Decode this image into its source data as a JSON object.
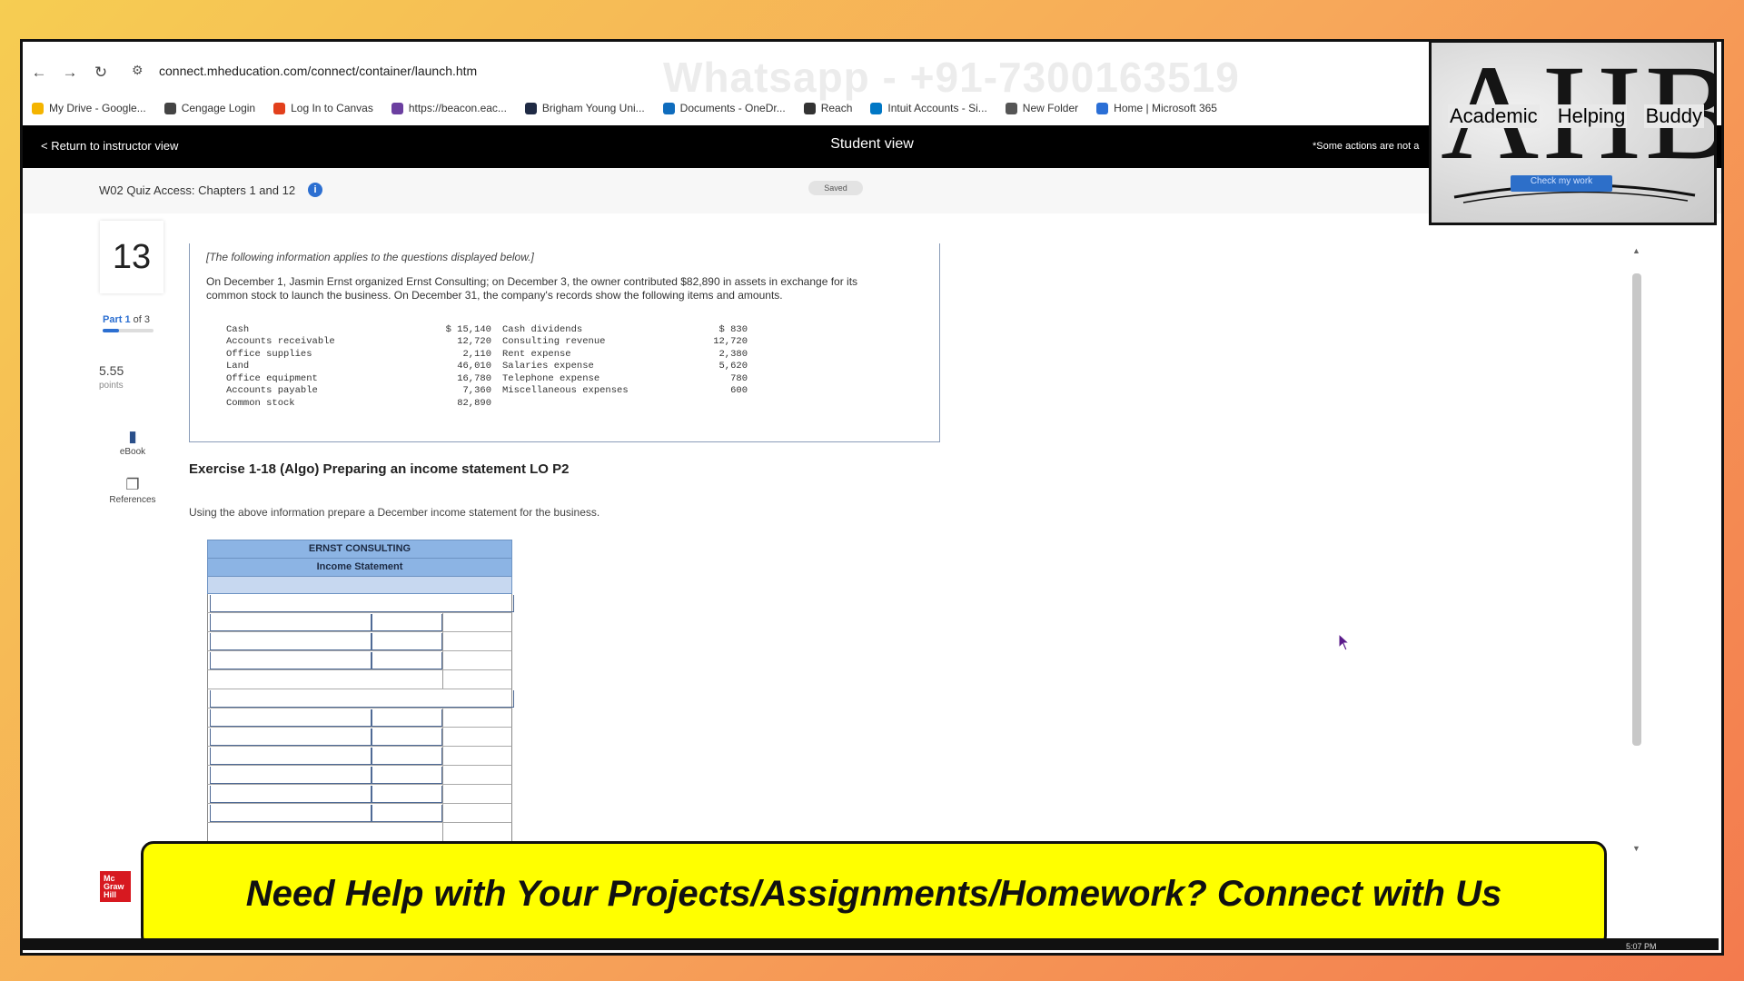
{
  "browser": {
    "url": "connect.mheducation.com/connect/container/launch.htm",
    "bookmarks": [
      {
        "label": "My Drive - Google...",
        "color": "#f4b400"
      },
      {
        "label": "Cengage Login",
        "color": "#444444"
      },
      {
        "label": "Log In to Canvas",
        "color": "#e2401c"
      },
      {
        "label": "https://beacon.eac...",
        "color": "#6b3fa0"
      },
      {
        "label": "Brigham Young Uni...",
        "color": "#1f2a44"
      },
      {
        "label": "Documents - OneDr...",
        "color": "#0f6cbd"
      },
      {
        "label": "Reach",
        "color": "#333333"
      },
      {
        "label": "Intuit Accounts - Si...",
        "color": "#0077c5"
      },
      {
        "label": "New Folder",
        "color": "#555555"
      },
      {
        "label": "Home | Microsoft 365",
        "color": "#2b6fd6"
      }
    ]
  },
  "watermark": "Whatsapp - +91-7300163519",
  "topbar": {
    "return_label": "< Return to instructor view",
    "center_label": "Student view",
    "right_note": "*Some actions are not a"
  },
  "subheader": {
    "quiz_title": "W02 Quiz Access: Chapters 1 and 12",
    "saved_label": "Saved",
    "check_work_label": "Check my work"
  },
  "question": {
    "number": "13",
    "part_prefix": "Part 1",
    "part_suffix": "of 3",
    "part_progress": 0.33,
    "points_value": "5.55",
    "points_label": "points",
    "tools": [
      {
        "label": "eBook",
        "icon": "book-icon"
      },
      {
        "label": "References",
        "icon": "document-icon"
      }
    ]
  },
  "info": {
    "italic_note": "[The following information applies to the questions displayed below.]",
    "paragraph": "On December 1, Jasmin Ernst organized Ernst Consulting; on December 3, the owner contributed $82,890 in assets in exchange for its common stock to launch the business. On December 31, the company's records show the following items and amounts.",
    "rows": [
      {
        "name": "Cash",
        "value": "$ 15,140",
        "name2": "Cash dividends",
        "value2": "$ 830"
      },
      {
        "name": "Accounts receivable",
        "value": "12,720",
        "name2": "Consulting revenue",
        "value2": "12,720"
      },
      {
        "name": "Office supplies",
        "value": "2,110",
        "name2": "Rent expense",
        "value2": "2,380"
      },
      {
        "name": "Land",
        "value": "46,010",
        "name2": "Salaries expense",
        "value2": "5,620"
      },
      {
        "name": "Office equipment",
        "value": "16,780",
        "name2": "Telephone expense",
        "value2": "780"
      },
      {
        "name": "Accounts payable",
        "value": "7,360",
        "name2": "Miscellaneous expenses",
        "value2": "600"
      },
      {
        "name": "Common stock",
        "value": "82,890",
        "name2": "",
        "value2": ""
      }
    ]
  },
  "exercise": {
    "title": "Exercise 1-18 (Algo) Preparing an income statement LO P2",
    "instruction": "Using the above information prepare a December income statement for the business."
  },
  "worksheet": {
    "company": "ERNST CONSULTING",
    "statement": "Income Statement"
  },
  "logo": {
    "letters": "AHB",
    "words": [
      "Academic",
      "Helping",
      "Buddy"
    ]
  },
  "mh_logo": "Mc Graw Hill",
  "banner": "Need Help with Your Projects/Assignments/Homework? Connect with Us",
  "clock": "5:07 PM"
}
